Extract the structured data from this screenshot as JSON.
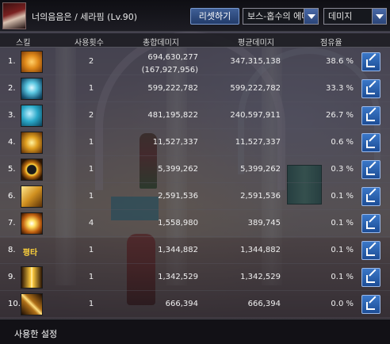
{
  "header": {
    "title": "너의음음은 / 세라핌 (Lv.90)",
    "reset_label": "리셋하기",
    "boss_filter": "보스-홉수의 에다",
    "metric_filter": "데미지"
  },
  "columns": {
    "skill": "스킬",
    "count": "사용횟수",
    "total": "총합데미지",
    "average": "평균데미지",
    "share": "점유율"
  },
  "rows": [
    {
      "index": "1.",
      "icon": "orange-sigil-skill-icon",
      "count": "2",
      "total": "694,630,277",
      "total_sub": "(167,927,956)",
      "average": "347,315,138",
      "share": "38.6 %"
    },
    {
      "index": "2.",
      "icon": "blue-pillars-skill-icon",
      "count": "1",
      "total": "599,222,782",
      "total_sub": "",
      "average": "599,222,782",
      "share": "33.3 %"
    },
    {
      "index": "3.",
      "icon": "cyan-swirl-skill-icon",
      "count": "2",
      "total": "481,195,822",
      "total_sub": "",
      "average": "240,597,911",
      "share": "26.7 %"
    },
    {
      "index": "4.",
      "icon": "gold-cross-skill-icon",
      "count": "1",
      "total": "11,527,337",
      "total_sub": "",
      "average": "11,527,337",
      "share": "0.6 %"
    },
    {
      "index": "5.",
      "icon": "gold-ring-skill-icon",
      "count": "1",
      "total": "5,399,262",
      "total_sub": "",
      "average": "5,399,262",
      "share": "0.3 %"
    },
    {
      "index": "6.",
      "icon": "gold-rune-skill-icon",
      "count": "1",
      "total": "2,591,536",
      "total_sub": "",
      "average": "2,591,536",
      "share": "0.1 %"
    },
    {
      "index": "7.",
      "icon": "light-burst-skill-icon",
      "count": "4",
      "total": "1,558,980",
      "total_sub": "",
      "average": "389,745",
      "share": "0.1 %"
    },
    {
      "index": "8.",
      "icon_text": "평타",
      "count": "1",
      "total": "1,344,882",
      "total_sub": "",
      "average": "1,344,882",
      "share": "0.1 %"
    },
    {
      "index": "9.",
      "icon": "light-pillar-skill-icon",
      "count": "1",
      "total": "1,342,529",
      "total_sub": "",
      "average": "1,342,529",
      "share": "0.1 %"
    },
    {
      "index": "10.",
      "icon": "holy-blade-skill-icon",
      "count": "1",
      "total": "666,394",
      "total_sub": "",
      "average": "666,394",
      "share": "0.0 %"
    }
  ],
  "footer": {
    "used_settings_label": "사용한 설정"
  }
}
